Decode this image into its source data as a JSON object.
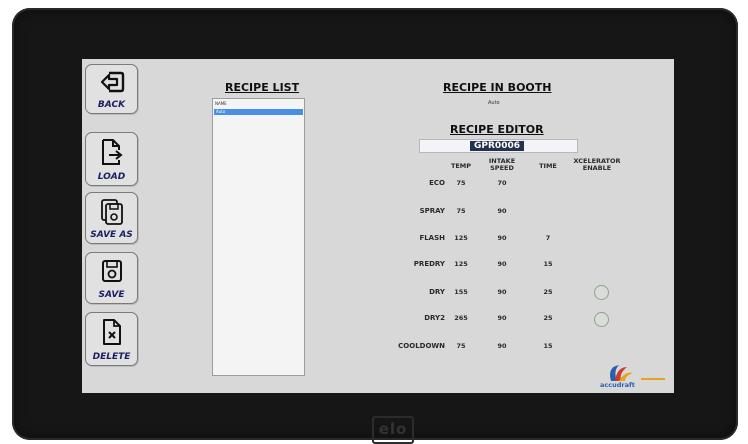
{
  "buttons": {
    "back": "BACK",
    "load": "LOAD",
    "save_as": "SAVE AS",
    "save": "SAVE",
    "delete": "DELETE"
  },
  "recipe_list": {
    "title": "RECIPE LIST",
    "header": "NAME",
    "selected_item": "Auto"
  },
  "recipe_in_booth": {
    "title": "RECIPE IN BOOTH",
    "value": "Auto"
  },
  "recipe_editor": {
    "title": "RECIPE EDITOR",
    "name": "GPR0006",
    "columns": {
      "temp": "TEMP",
      "intake_speed": "INTAKE SPEED",
      "time": "TIME",
      "xcelerator": "XCELERATOR ENABLE"
    },
    "rows": [
      {
        "label": "ECO",
        "temp": "75",
        "intake": "70",
        "time": ""
      },
      {
        "label": "SPRAY",
        "temp": "75",
        "intake": "90",
        "time": ""
      },
      {
        "label": "FLASH",
        "temp": "125",
        "intake": "90",
        "time": "7"
      },
      {
        "label": "PREDRY",
        "temp": "125",
        "intake": "90",
        "time": "15"
      },
      {
        "label": "DRY",
        "temp": "155",
        "intake": "90",
        "time": "25"
      },
      {
        "label": "DRY2",
        "temp": "265",
        "intake": "90",
        "time": "25"
      },
      {
        "label": "COOLDOWN",
        "temp": "75",
        "intake": "90",
        "time": "15"
      }
    ]
  },
  "logo_text": "accudraft",
  "bezel_brand": "elo",
  "colors": {
    "screen_bg": "#d8d8d8",
    "bezel": "#161616",
    "selection": "#4a90e2",
    "name_highlight": "#24324f"
  }
}
